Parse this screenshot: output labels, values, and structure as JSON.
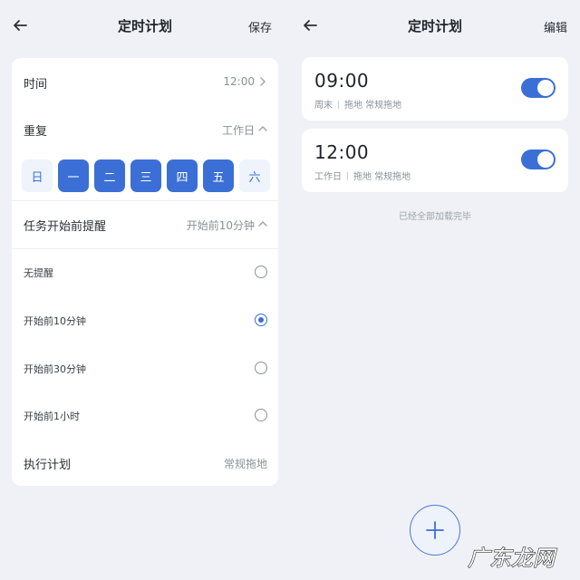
{
  "left": {
    "header": {
      "title": "定时计划",
      "save_label": "保存"
    },
    "time_row": {
      "label": "时间",
      "value": "12:00"
    },
    "repeat_row": {
      "label": "重复",
      "value": "工作日"
    },
    "days": [
      {
        "label": "日",
        "selected": false
      },
      {
        "label": "一",
        "selected": true
      },
      {
        "label": "二",
        "selected": true
      },
      {
        "label": "三",
        "selected": true
      },
      {
        "label": "四",
        "selected": true
      },
      {
        "label": "五",
        "selected": true
      },
      {
        "label": "六",
        "selected": false
      }
    ],
    "reminder_row": {
      "label": "任务开始前提醒",
      "value": "开始前10分钟"
    },
    "reminder_options": [
      {
        "label": "无提醒",
        "checked": false
      },
      {
        "label": "开始前10分钟",
        "checked": true
      },
      {
        "label": "开始前30分钟",
        "checked": false
      },
      {
        "label": "开始前1小时",
        "checked": false
      }
    ],
    "plan_row": {
      "label": "执行计划",
      "value": "常规拖地"
    }
  },
  "right": {
    "header": {
      "title": "定时计划",
      "edit_label": "编辑"
    },
    "plans": [
      {
        "time": "09:00",
        "repeat": "周末",
        "mode": "拖地 常规拖地",
        "enabled": true
      },
      {
        "time": "12:00",
        "repeat": "工作日",
        "mode": "拖地 常规拖地",
        "enabled": true
      }
    ],
    "loaded_text": "已经全部加载完毕"
  },
  "watermark": {
    "text": "广东龙网"
  },
  "colors": {
    "accent": "#3b6fd6",
    "background": "#eff1f6",
    "card": "#ffffff"
  }
}
